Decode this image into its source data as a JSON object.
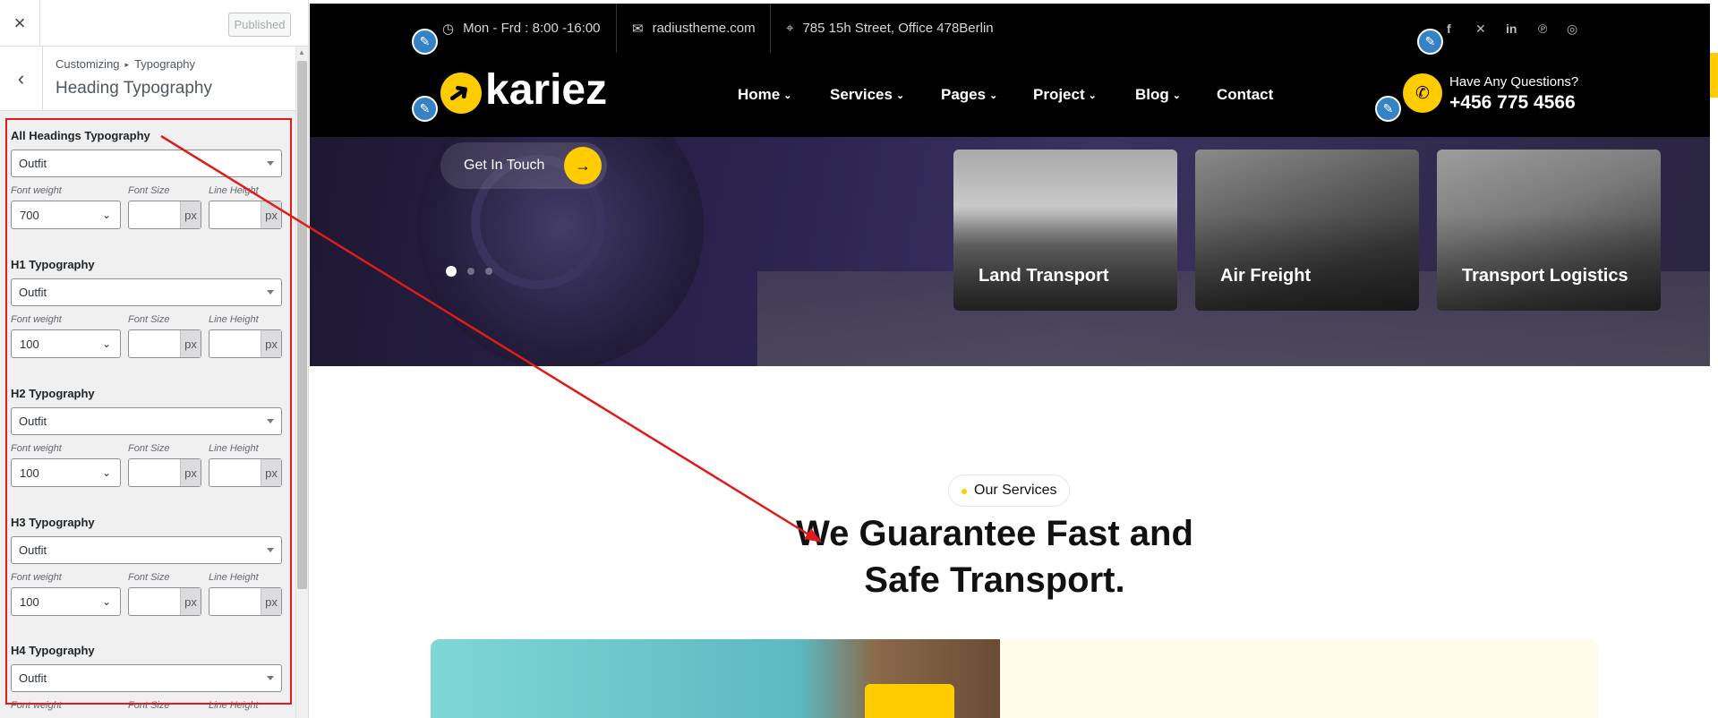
{
  "customizer": {
    "close_icon": "×",
    "published_label": "Published",
    "back_icon": "‹",
    "breadcrumb_root": "Customizing",
    "breadcrumb_separator": "▸",
    "breadcrumb_section": "Typography",
    "section_title": "Heading Typography",
    "font_weight_label": "Font weight",
    "font_size_label": "Font Size",
    "line_height_label": "Line Height",
    "unit_label": "px",
    "groups": [
      {
        "title": "All Headings Typography",
        "font": "Outfit",
        "weight": "700"
      },
      {
        "title": "H1 Typography",
        "font": "Outfit",
        "weight": "100"
      },
      {
        "title": "H2 Typography",
        "font": "Outfit",
        "weight": "100"
      },
      {
        "title": "H3 Typography",
        "font": "Outfit",
        "weight": "100"
      },
      {
        "title": "H4 Typography",
        "font": "Outfit"
      }
    ]
  },
  "site": {
    "topbar": {
      "hours": "Mon - Frd : 8:00 -16:00",
      "email": "radiustheme.com",
      "address": "785 15h Street, Office 478Berlin",
      "social_icons": [
        "facebook-icon",
        "x-icon",
        "linkedin-icon",
        "pinterest-icon",
        "instagram-icon"
      ]
    },
    "logo_text": "kariez",
    "nav": [
      "Home",
      "Services",
      "Pages",
      "Project",
      "Blog",
      "Contact"
    ],
    "nav_has_dropdown": [
      true,
      true,
      true,
      true,
      true,
      false
    ],
    "contact_question": "Have Any Questions?",
    "contact_phone": "+456 775 4566",
    "hero": {
      "cta_label": "Get In Touch",
      "slide_count": 3,
      "active_slide": 1,
      "cards": [
        "Land Transport",
        "Air Freight",
        "Transport Logistics"
      ]
    },
    "services_badge": "Our Services",
    "heading_line1": "We Guarantee Fast and",
    "heading_line2": "Safe Transport."
  },
  "colors": {
    "accent_yellow": "#ffcc00",
    "annotation_red": "#e01b1b",
    "edit_blue": "#3582c4"
  }
}
